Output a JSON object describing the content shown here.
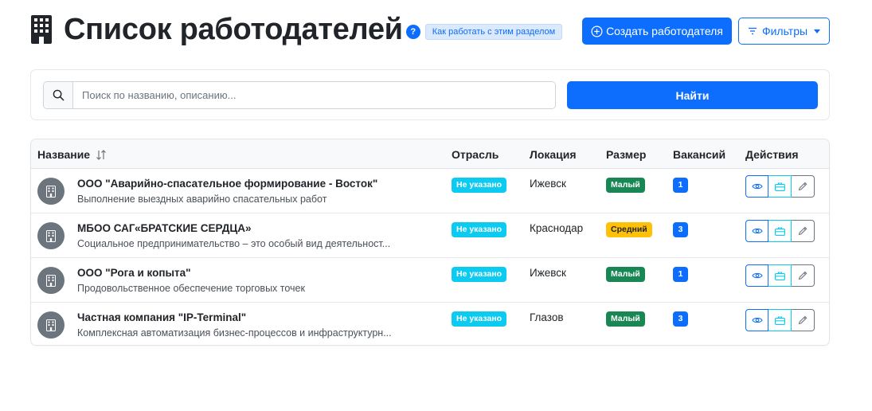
{
  "header": {
    "icon": "building-icon",
    "title": "Список работодателей",
    "help_badge": "?",
    "help_link": "Как работать с этим разделом",
    "create_button": "Создать работодателя",
    "filters_button": "Фильтры"
  },
  "search": {
    "placeholder": "Поиск по названию, описанию...",
    "value": "",
    "button": "Найти"
  },
  "table": {
    "columns": {
      "name": "Название",
      "industry": "Отрасль",
      "location": "Локация",
      "size": "Размер",
      "vacancies": "Вакансий",
      "actions": "Действия"
    },
    "rows": [
      {
        "name": "ООО \"Аварийно-спасательное формирование - Восток\"",
        "description": "Выполнение выездных аварийно спасательных работ",
        "industry": "Не указано",
        "location": "Ижевск",
        "size": "Малый",
        "size_color": "#198754",
        "vacancies": "1"
      },
      {
        "name": "МБОО САГ«БРАТСКИЕ СЕРДЦА»",
        "description": "Социальное предпринимательство – это особый вид деятельност...",
        "industry": "Не указано",
        "location": "Краснодар",
        "size": "Средний",
        "size_color": "#ffc107",
        "vacancies": "3"
      },
      {
        "name": "ООО \"Рога и копыта\"",
        "description": "Продовольственное обеспечение торговых точек",
        "industry": "Не указано",
        "location": "Ижевск",
        "size": "Малый",
        "size_color": "#198754",
        "vacancies": "1"
      },
      {
        "name": "Частная компания \"IP-Terminal\"",
        "description": "Комплексная автоматизация бизнес-процессов и инфраструктурн...",
        "industry": "Не указано",
        "location": "Глазов",
        "size": "Малый",
        "size_color": "#198754",
        "vacancies": "3"
      }
    ]
  },
  "colors": {
    "primary": "#0d6efd",
    "info": "#0dcaf0",
    "success": "#198754",
    "warning": "#ffc107",
    "secondary": "#6c757d"
  }
}
